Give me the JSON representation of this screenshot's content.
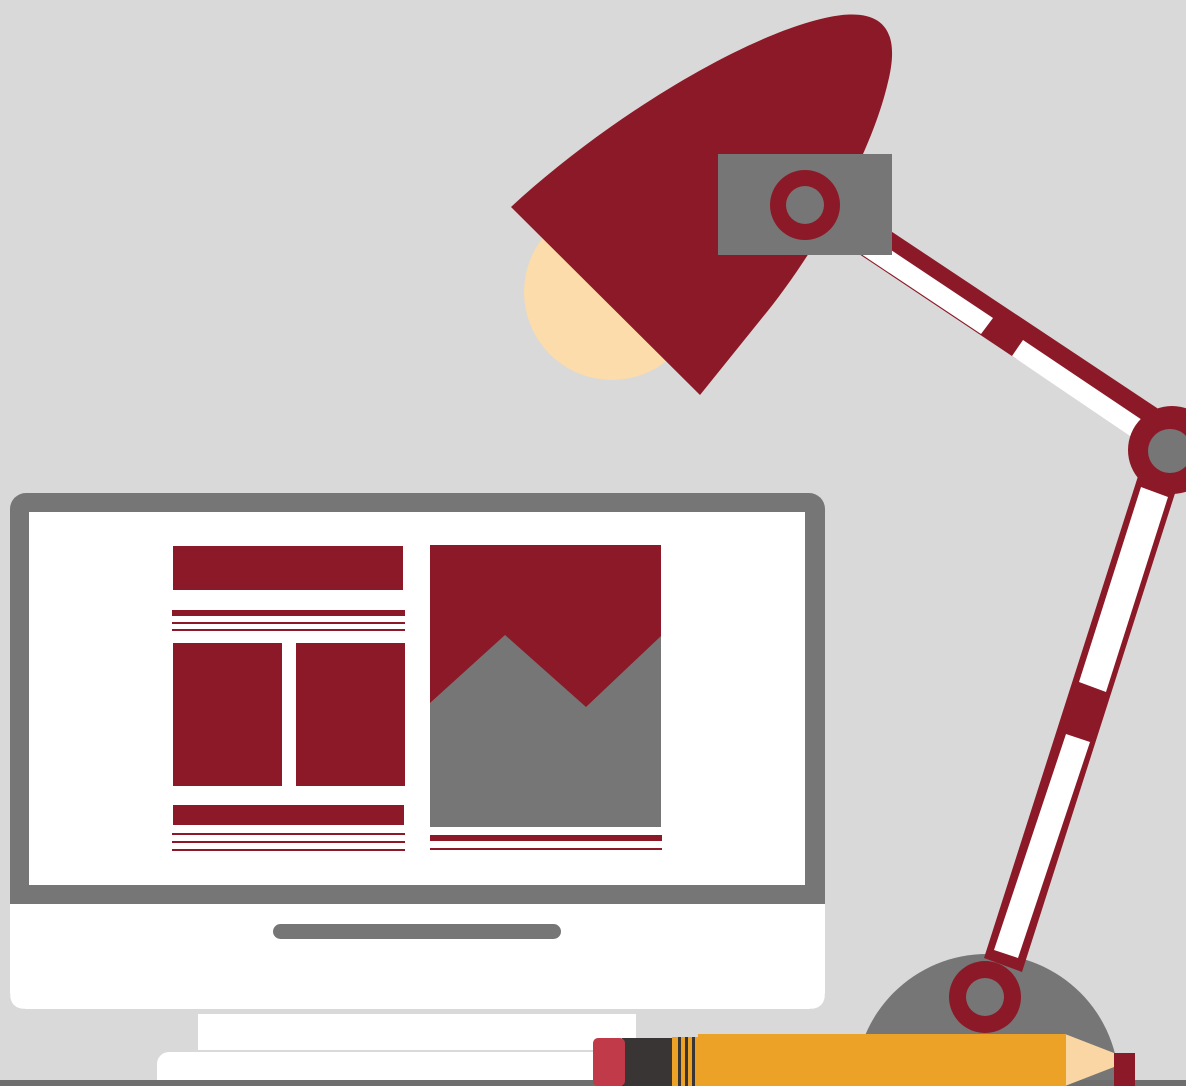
{
  "scene": {
    "subject": "desk-illustration",
    "palette": {
      "background": "#d9d9d9",
      "maroon": "#8c1927",
      "gray": "#767676",
      "white": "#ffffff",
      "bulb": "#fbdcaa",
      "pencil_body": "#eba227",
      "pencil_stripe": "#3a3535",
      "pencil_eraser": "#c13a4a",
      "pencil_wood": "#fad6a5",
      "shelf": "#6e6e6e"
    },
    "objects": [
      {
        "name": "desk-lamp",
        "icon": "lamp-icon"
      },
      {
        "name": "desktop-monitor",
        "icon": "monitor-icon"
      },
      {
        "name": "pencil",
        "icon": "pencil-icon"
      }
    ]
  }
}
